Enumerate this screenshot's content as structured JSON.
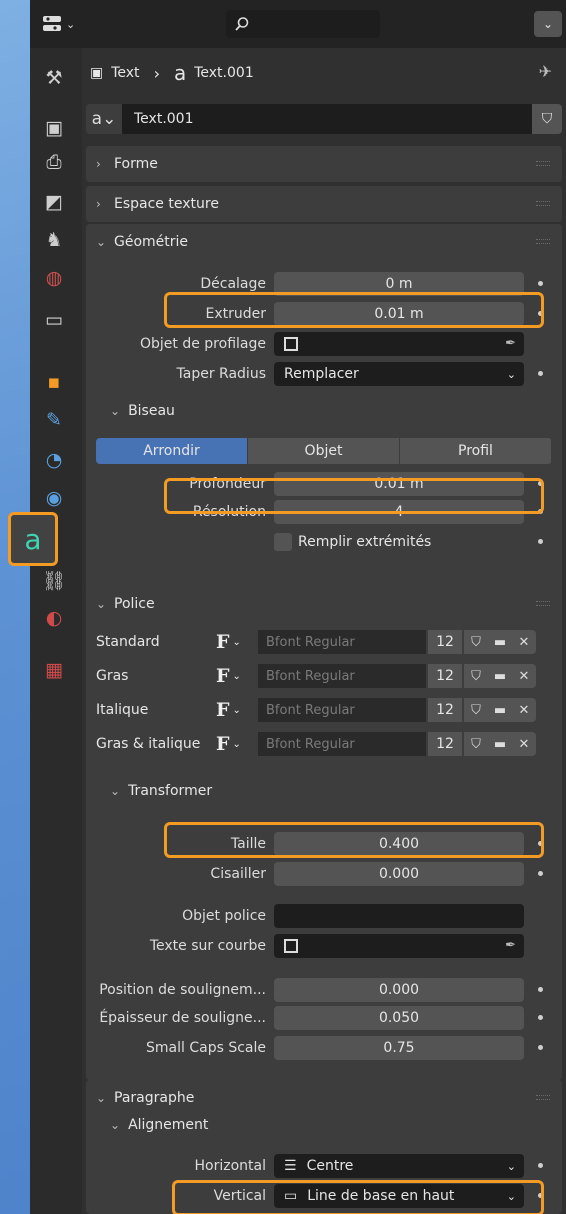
{
  "topbar": {
    "editor_icon": "editor-type-icon",
    "search_icon": "search-icon",
    "dropdown": "⌄"
  },
  "sidebar": {
    "icons": [
      "tool-icon",
      "render-icon",
      "output-icon",
      "view-layer-icon",
      "scene-icon",
      "world-icon",
      "collection-icon",
      "object-icon",
      "modifier-icon",
      "particles-icon",
      "physics-icon",
      "text-data-icon",
      "constraints-icon",
      "material-icon",
      "texture-icon"
    ]
  },
  "breadcrumb": {
    "object": "Text",
    "data": "Text.001"
  },
  "datablock": {
    "name": "Text.001"
  },
  "panels": {
    "forme": "Forme",
    "espace": "Espace texture",
    "geometrie": "Géométrie",
    "police": "Police",
    "paragraphe": "Paragraphe"
  },
  "geometry": {
    "decalage_label": "Décalage",
    "decalage_value": "0 m",
    "extruder_label": "Extruder",
    "extruder_value": "0.01 m",
    "profil_label": "Objet de profilage",
    "taper_label": "Taper Radius",
    "taper_value": "Remplacer",
    "biseau": "Biseau",
    "modes": [
      "Arrondir",
      "Objet",
      "Profil"
    ],
    "profondeur_label": "Profondeur",
    "profondeur_value": "0.01 m",
    "resolution_label": "Résolution",
    "resolution_value": "4",
    "remplir_label": "Remplir extrémités"
  },
  "police": {
    "rows": [
      {
        "label": "Standard",
        "font": "Bfont Regular",
        "users": "12"
      },
      {
        "label": "Gras",
        "font": "Bfont Regular",
        "users": "12"
      },
      {
        "label": "Italique",
        "font": "Bfont Regular",
        "users": "12"
      },
      {
        "label": "Gras & italique",
        "font": "Bfont Regular",
        "users": "12"
      }
    ],
    "transformer": "Transformer",
    "taille_label": "Taille",
    "taille_value": "0.400",
    "cisailler_label": "Cisailler",
    "cisailler_value": "0.000",
    "objet_police_label": "Objet police",
    "texte_courbe_label": "Texte sur courbe",
    "pos_soul_label": "Position de soulignem...",
    "pos_soul_value": "0.000",
    "ep_soul_label": "Épaisseur de souligne...",
    "ep_soul_value": "0.050",
    "smallcaps_label": "Small Caps Scale",
    "smallcaps_value": "0.75"
  },
  "paragraphe": {
    "alignement": "Alignement",
    "horizontal_label": "Horizontal",
    "horizontal_value": "Centre",
    "vertical_label": "Vertical",
    "vertical_value": "Line de base en haut"
  },
  "accent": "#f39b24"
}
